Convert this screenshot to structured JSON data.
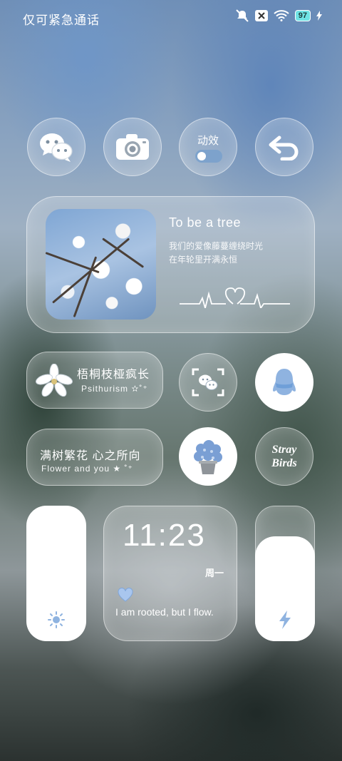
{
  "status_bar": {
    "carrier_text": "仅可紧急通话",
    "battery": "97",
    "icons": [
      "mute-bell-icon",
      "x-badge-icon",
      "wifi-icon",
      "battery-icon",
      "charging-icon"
    ]
  },
  "top_row": {
    "wechat_icon": "wechat-icon",
    "camera_icon": "camera-icon",
    "animation_label": "动效",
    "back_icon": "back-arrow-icon"
  },
  "music_card": {
    "title": "To be a tree",
    "line1": "我们的爱像藤蔓缠绕时光",
    "line2": "在年轮里开满永恒"
  },
  "row2": {
    "pill_title": "梧桐枝桠疯长",
    "pill_sub": "Psithurism ✫˚⁺"
  },
  "row3": {
    "pill_title": "满树繁花 心之所向",
    "pill_sub": "Flower and you ★ ˚⁺",
    "stray_line1": "Stray",
    "stray_line2": "Birds"
  },
  "clock_widget": {
    "time": "11:23",
    "weekday": "周一",
    "quote": "I am rooted, but I flow."
  },
  "colors": {
    "accent": "#6f9fd8",
    "glass_border": "#ffffff"
  }
}
